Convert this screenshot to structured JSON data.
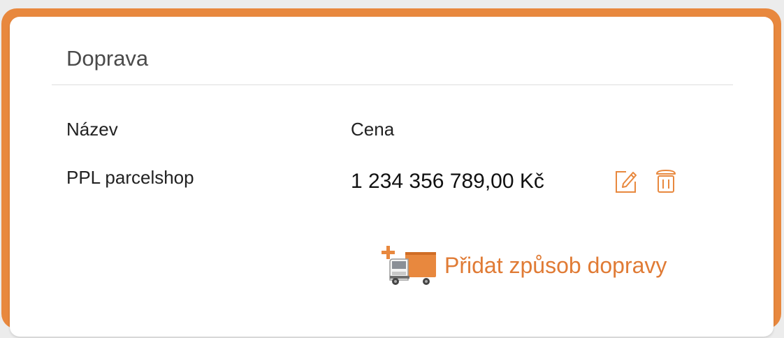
{
  "section": {
    "title": "Doprava"
  },
  "table": {
    "headers": {
      "name": "Název",
      "price": "Cena"
    },
    "rows": [
      {
        "name": "PPL parcelshop",
        "price": "1 234 356 789,00 Kč"
      }
    ],
    "actions": {
      "edit_icon": "edit-icon",
      "delete_icon": "trash-icon"
    }
  },
  "add_action": {
    "label": "Přidat způsob dopravy",
    "icon": "truck-add-icon"
  },
  "colors": {
    "accent": "#e8883e",
    "link": "#e07b35",
    "background": "#ececec",
    "card": "#ffffff"
  }
}
